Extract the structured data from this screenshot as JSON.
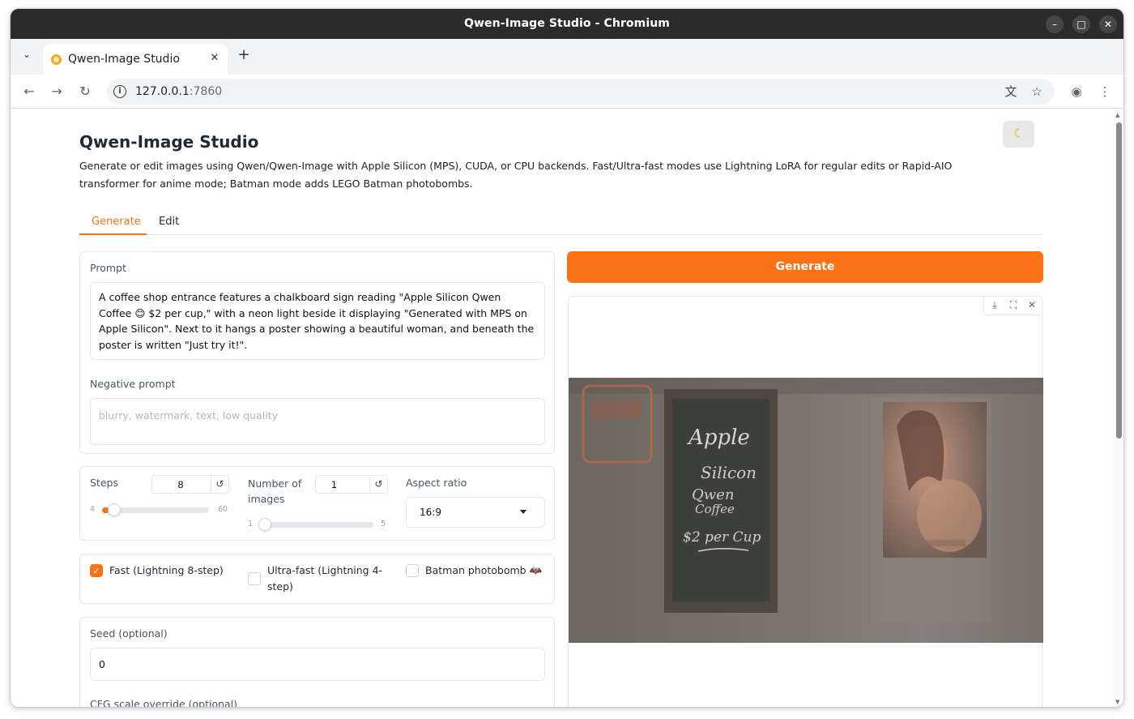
{
  "window": {
    "title": "Qwen-Image Studio - Chromium"
  },
  "browser": {
    "tab_title": "Qwen-Image Studio",
    "url_host": "127.0.0.1",
    "url_port": ":7860"
  },
  "app": {
    "title": "Qwen-Image Studio",
    "theme_icon": "moon-icon",
    "description": "Generate or edit images using Qwen/Qwen-Image with Apple Silicon (MPS), CUDA, or CPU backends. Fast/Ultra-fast modes use Lightning LoRA for regular edits or Rapid-AIO transformer for anime mode; Batman mode adds LEGO Batman photobombs.",
    "tabs": [
      {
        "label": "Generate",
        "active": true
      },
      {
        "label": "Edit",
        "active": false
      }
    ]
  },
  "form": {
    "prompt_label": "Prompt",
    "prompt_value": "A coffee shop entrance features a chalkboard sign reading \"Apple Silicon Qwen Coffee 😊 $2 per cup,\" with a neon light beside it displaying \"Generated with MPS on Apple Silicon\". Next to it hangs a poster showing a beautiful woman, and beneath the poster is written \"Just try it!\".",
    "negative_label": "Negative prompt",
    "negative_placeholder": "blurry, watermark, text, low quality",
    "steps": {
      "label": "Steps",
      "value": "8",
      "min": "4",
      "max": "60",
      "fraction": 0.07
    },
    "num_images": {
      "label": "Number of images",
      "value": "1",
      "min": "1",
      "max": "5",
      "fraction": 0.0
    },
    "aspect": {
      "label": "Aspect ratio",
      "value": "16:9"
    },
    "options": [
      {
        "label": "Fast (Lightning 8-step)",
        "checked": true
      },
      {
        "label": "Ultra-fast (Lightning 4-step)",
        "checked": false
      },
      {
        "label": "Batman photobomb 🦇",
        "checked": false
      }
    ],
    "seed_label": "Seed (optional)",
    "seed_value": "0",
    "cfg_label": "CFG scale override (optional)"
  },
  "output": {
    "generate_label": "Generate",
    "image_text": {
      "apple": "Apple",
      "silicon": "Silicon",
      "qwen": "Qwen",
      "coffee": "Coffee",
      "price": "$2 per Cup"
    }
  },
  "colors": {
    "accent": "#f97316",
    "titlebar": "#2b2b2b"
  }
}
